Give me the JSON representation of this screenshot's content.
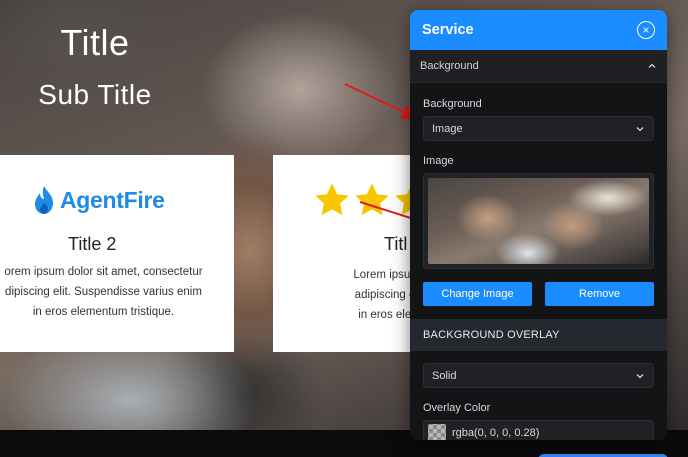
{
  "hero": {
    "title": "Title",
    "subtitle": "Sub Title"
  },
  "cards": [
    {
      "logo_text": "AgentFire",
      "title": "Title 2",
      "body_lines": [
        "orem ipsum dolor sit amet, consectetur",
        "dipiscing elit. Suspendisse varius enim",
        "in eros elementum tristique."
      ]
    },
    {
      "title": "Titl",
      "body_lines": [
        "Lorem ipsum dolor s",
        "adipiscing elit. Susp",
        "in eros elementum"
      ],
      "rating_visible_stars": 3
    }
  ],
  "panel": {
    "title": "Service",
    "section_label": "Background",
    "background_field_label": "Background",
    "background_value": "Image",
    "image_field_label": "Image",
    "change_image_label": "Change Image",
    "remove_label": "Remove",
    "overlay_section_label": "BACKGROUND OVERLAY",
    "overlay_type_value": "Solid",
    "overlay_color_label": "Overlay Color",
    "overlay_color_value": "rgba(0, 0, 0, 0.28)"
  },
  "colors": {
    "accent": "#1a8cff",
    "panel_bg": "#131416",
    "star": "#f7c600",
    "arrow": "#e01b1b",
    "logo": "#1f8be6"
  },
  "icons": {
    "close": "close-circle-icon",
    "collapse": "chevron-up-icon",
    "dropdown": "chevron-down-icon",
    "logo": "flame-logo-icon",
    "star": "star-icon"
  }
}
